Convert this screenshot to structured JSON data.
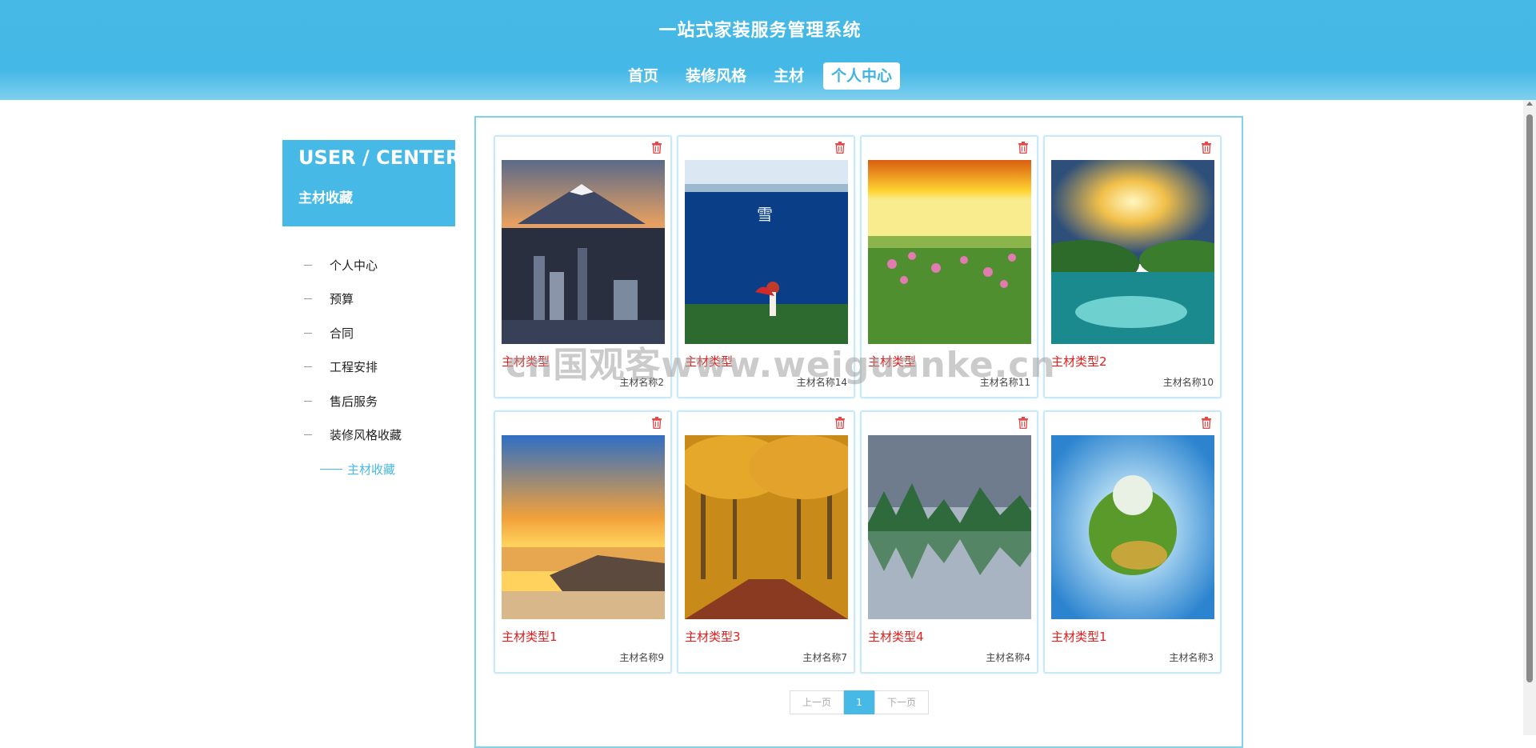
{
  "site": {
    "title": "一站式家装服务管理系统"
  },
  "nav": [
    {
      "label": "首页"
    },
    {
      "label": "装修风格"
    },
    {
      "label": "主材"
    },
    {
      "label": "个人中心",
      "active": true
    }
  ],
  "sidebar": {
    "heading_en": "USER / CENTER",
    "heading_zh": "主材收藏",
    "items": [
      {
        "label": "个人中心"
      },
      {
        "label": "预算"
      },
      {
        "label": "合同"
      },
      {
        "label": "工程安排"
      },
      {
        "label": "售后服务"
      },
      {
        "label": "装修风格收藏"
      },
      {
        "label": "主材收藏",
        "active": true
      }
    ]
  },
  "cards": [
    {
      "type": "主材类型",
      "name": "主材名称2",
      "image": "mountain-city"
    },
    {
      "type": "主材类型",
      "name": "主材名称14",
      "image": "lake-girl"
    },
    {
      "type": "主材类型",
      "name": "主材名称11",
      "image": "sunset-flowers"
    },
    {
      "type": "主材类型2",
      "name": "主材名称10",
      "image": "sunrise-lake"
    },
    {
      "type": "主材类型1",
      "name": "主材名称9",
      "image": "beach-sunset"
    },
    {
      "type": "主材类型3",
      "name": "主材名称7",
      "image": "autumn-road"
    },
    {
      "type": "主材类型4",
      "name": "主材名称4",
      "image": "karst-reflection"
    },
    {
      "type": "主材类型1",
      "name": "主材名称3",
      "image": "tiny-planet"
    }
  ],
  "pagination": {
    "prev": "上一页",
    "current": "1",
    "next": "下一页"
  },
  "watermark": "cn国观客www.weiguanke.cn",
  "colors": {
    "primary": "#46b9e6",
    "type_text": "#e0201e",
    "trash": "#e84747"
  }
}
